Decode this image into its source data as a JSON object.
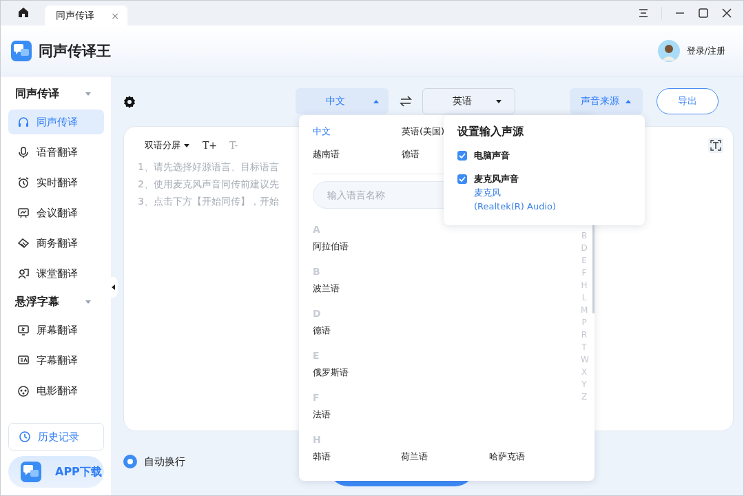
{
  "window": {
    "tab": {
      "label": "同声传译",
      "selected": true,
      "close": "×"
    }
  },
  "header": {
    "app_name": "同声传译王",
    "login": "登录/注册"
  },
  "sidebar": {
    "sections": [
      {
        "title": "同声传译",
        "expanded": true,
        "items": [
          {
            "label": "同声传译",
            "selected": true
          },
          {
            "label": "语音翻译",
            "selected": false
          },
          {
            "label": "实时翻译",
            "selected": false
          },
          {
            "label": "会议翻译",
            "selected": false
          },
          {
            "label": "商务翻译",
            "selected": false
          },
          {
            "label": "课堂翻译",
            "selected": false
          }
        ]
      },
      {
        "title": "悬浮字幕",
        "expanded": true,
        "items": [
          {
            "label": "屏幕翻译",
            "selected": false
          },
          {
            "label": "字幕翻译",
            "selected": false
          },
          {
            "label": "电影翻译",
            "selected": false
          }
        ]
      }
    ],
    "history": "历史记录",
    "app_download": "APP下载"
  },
  "toolbar": {
    "source": {
      "label": "中文",
      "expanded": true
    },
    "target": {
      "label": "英语",
      "expanded": false
    },
    "sound_source": {
      "label": "声音来源",
      "expanded": true
    },
    "export": "导出"
  },
  "editor": {
    "view_mode": "双语分屏",
    "font_larger": {
      "label": "T+",
      "disabled": false
    },
    "font_smaller": {
      "label": "T-",
      "disabled": true
    },
    "hints": [
      "1、请先选择好源语言、目标语言",
      "2、使用麦克风声音同传前建议先",
      "3、点击下方【开始同传】，开始"
    ]
  },
  "auto_wrap": {
    "label": "自动换行",
    "checked": true
  },
  "language_menu": {
    "recent": [
      {
        "label": "中文",
        "selected": true
      },
      {
        "label": "英语(美国)",
        "selected": false
      },
      {
        "label": "越南语",
        "selected": false
      },
      {
        "label": "德语",
        "selected": false
      }
    ],
    "search": {
      "placeholder": "输入语言名称"
    },
    "groups": [
      {
        "letter": "A",
        "languages": [
          "阿拉伯语"
        ]
      },
      {
        "letter": "B",
        "languages": [
          "波兰语"
        ]
      },
      {
        "letter": "D",
        "languages": [
          "德语"
        ]
      },
      {
        "letter": "E",
        "languages": [
          "俄罗斯语"
        ]
      },
      {
        "letter": "F",
        "languages": [
          "法语"
        ]
      },
      {
        "letter": "H",
        "languages": [
          "韩语",
          "荷兰语",
          "哈萨克语"
        ]
      }
    ],
    "index": [
      "B",
      "D",
      "E",
      "F",
      "H",
      "L",
      "M",
      "P",
      "R",
      "T",
      "W",
      "X",
      "Y",
      "Z"
    ]
  },
  "sound_menu": {
    "title": "设置输入声源",
    "options": [
      {
        "label": "电脑声音",
        "checked": true
      },
      {
        "label": "麦克风声音",
        "checked": true,
        "device": "麦克风",
        "device_detail": "(Realtek(R) Audio)"
      }
    ]
  }
}
